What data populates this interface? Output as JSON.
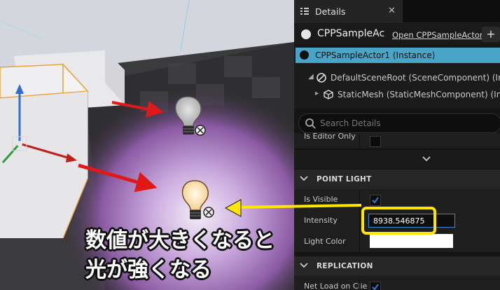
{
  "colors": {
    "selection": "#49a5c8",
    "annotation_yellow": "#ffe600",
    "arrow_red": "#e01818",
    "focus_border": "#3d8bd1"
  },
  "details": {
    "tab": {
      "label": "Details",
      "icon": "details-panel-icon",
      "close": "✕"
    },
    "actor": {
      "name": "CPPSampleAc",
      "open_link": "Open CPPSampleActor",
      "add": "+"
    },
    "components": [
      {
        "label": "CPPSampleActor1 (Instance)",
        "icon": "actor-sphere-icon",
        "selected": true
      },
      {
        "label": "DefaultSceneRoot (SceneComponent) (Inhe",
        "icon": "scene-root-icon",
        "selected": false
      },
      {
        "label": "StaticMesh (StaticMeshComponent) (Inhe",
        "icon": "cube-icon",
        "selected": false
      }
    ],
    "search": {
      "placeholder": "Search Details"
    },
    "editor_only": {
      "label": "Is Editor Only",
      "checked": false
    },
    "sections": {
      "point_light": {
        "title": "POINT LIGHT",
        "is_visible": {
          "label": "Is Visible",
          "checked": true
        },
        "intensity": {
          "label": "Intensity",
          "value": "8938.546875"
        },
        "light_color": {
          "label": "Light Color",
          "value": "#ffffff"
        }
      },
      "replication": {
        "title": "REPLICATION",
        "net_load": {
          "label": "Net Load on Clie",
          "checked": true
        }
      }
    }
  },
  "annotation": {
    "line1": "数値が大きくなると",
    "line2": "光が強くなる"
  }
}
